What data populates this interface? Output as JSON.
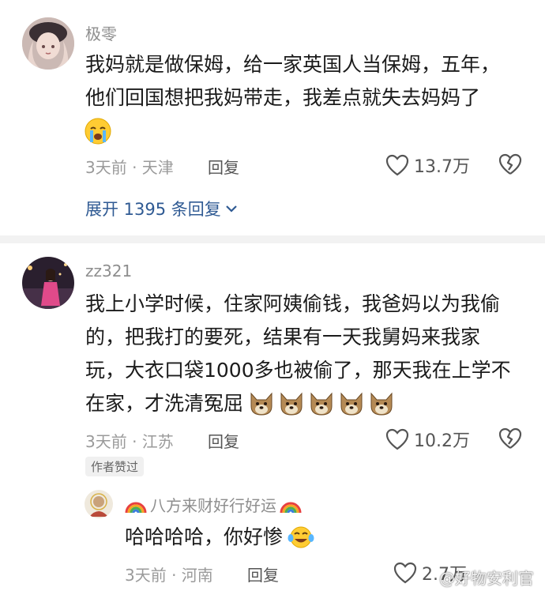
{
  "comments": [
    {
      "username": "极零",
      "lines": [
        "我妈就是做保姆，给一家英国人当保姆，五年，",
        "他们回国想把我妈带走，我差点就失去妈妈了"
      ],
      "emoji": "loudly-crying-emoji",
      "time_location": "3天前 · 天津",
      "reply_label": "回复",
      "likes": "13.7万",
      "expand_label": "展开 1395 条回复"
    },
    {
      "username": "zz321",
      "lines": [
        "我上小学时候，住家阿姨偷钱，我爸妈以为我偷",
        "的，把我打的要死，结果有一天我舅妈来我家",
        "玩，大衣口袋1000多也被偷了，那天我在上学不",
        "在家，才洗清冤屈"
      ],
      "emoji": "dog-face-emoji",
      "time_location": "3天前 · 江苏",
      "reply_label": "回复",
      "likes": "10.2万",
      "badge": "作者赞过",
      "reply": {
        "username": "八方来财好行好运",
        "text": "哈哈哈哈，你好惨",
        "emoji": "tears-of-joy-emoji",
        "time_location": "3天前 · 河南",
        "reply_label": "回复",
        "likes": "2.7万"
      }
    }
  ],
  "watermark": "@好物安利官",
  "colors": {
    "link": "#2f5a93",
    "meta": "#9a9a9a",
    "text": "#1b1b1b",
    "divider": "#f2f2f2"
  },
  "icons": [
    "heart-outline-icon",
    "broken-heart-icon",
    "chevron-down-icon",
    "rainbow-emoji"
  ]
}
